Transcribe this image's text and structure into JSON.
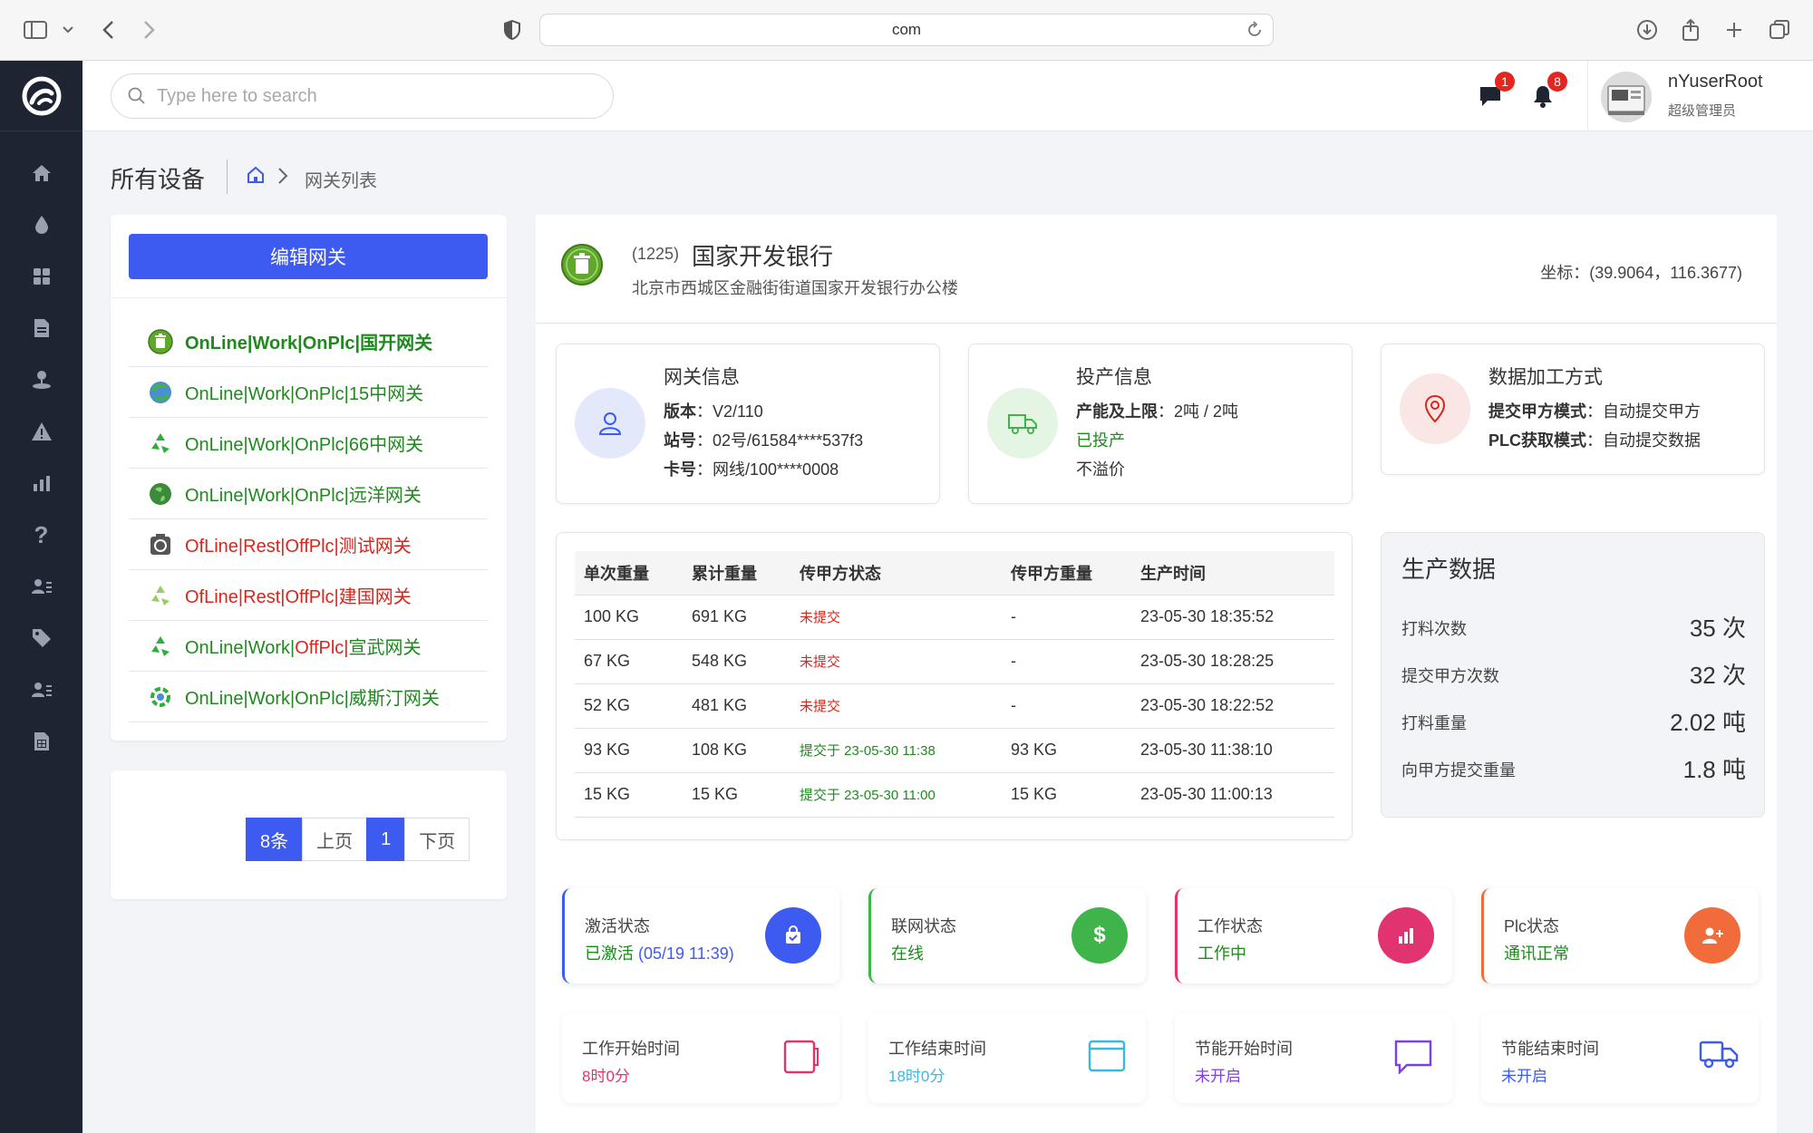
{
  "browser": {
    "url": "com"
  },
  "search": {
    "placeholder": "Type here to search"
  },
  "header": {
    "messages_badge": "1",
    "notifications_badge": "8",
    "user_name": "nYuserRoot",
    "user_role": "超级管理员"
  },
  "page": {
    "title": "所有设备",
    "breadcrumb": "网关列表"
  },
  "gateways": {
    "edit_button": "编辑网关",
    "items": [
      {
        "status": "OnLine|Work|OnPlc|",
        "status_color": "green",
        "name": "国开网关",
        "icon": "trash-can-icon"
      },
      {
        "status": "OnLine|Work|OnPlc|",
        "status_color": "green",
        "name": "15中网关",
        "icon": "recycle-globe-icon"
      },
      {
        "status": "OnLine|Work|OnPlc|",
        "status_color": "green",
        "name": "66中网关",
        "icon": "recycle-icon"
      },
      {
        "status": "OnLine|Work|OnPlc|",
        "status_color": "green",
        "name": "远洋网关",
        "icon": "recycle-globe-icon"
      },
      {
        "status": "OfLine|Rest|OffPlc|",
        "status_color": "red",
        "name": "测试网关",
        "icon": "recycle-bin-icon"
      },
      {
        "status": "OfLine|Rest|OffPlc|",
        "status_color": "red",
        "name": "建国网关",
        "icon": "recycle-icon"
      },
      {
        "status_parts": [
          "OnLine|Work|",
          "OffPlc|"
        ],
        "status_color": "mixed",
        "name": "宣武网关",
        "icon": "recycle-icon"
      },
      {
        "status": "OnLine|Work|OnPlc|",
        "status_color": "green",
        "name": "威斯汀网关",
        "icon": "recycle-gear-icon"
      }
    ]
  },
  "pagination": {
    "count": "8条",
    "prev": "上页",
    "current": "1",
    "next": "下页"
  },
  "bank": {
    "id": "(1225)",
    "name": "国家开发银行",
    "address": "北京市西城区金融街街道国家开发银行办公楼",
    "coordinates": "坐标：(39.9064，116.3677)"
  },
  "gateway_info": {
    "title": "网关信息",
    "version_label": "版本",
    "version": "：V2/110",
    "station_label": "站号",
    "station": "：02号/61584****537f3",
    "card_label": "卡号",
    "card": "：网线/100****0008"
  },
  "production_info": {
    "title": "投产信息",
    "capacity_label": "产能及上限",
    "capacity": "：2吨 / 2吨",
    "status": "已投产",
    "overflow": "不溢价"
  },
  "processing": {
    "title": "数据加工方式",
    "submit_label": "提交甲方模式",
    "submit_value": "：自动提交甲方",
    "plc_label": "PLC获取模式",
    "plc_value": "：自动提交数据"
  },
  "table": {
    "headers": [
      "单次重量",
      "累计重量",
      "传甲方状态",
      "传甲方重量",
      "生产时间"
    ],
    "rows": [
      {
        "single": "100 KG",
        "total": "691 KG",
        "status": "未提交",
        "status_color": "red",
        "submitted": "-",
        "time": "23-05-30 18:35:52"
      },
      {
        "single": "67 KG",
        "total": "548 KG",
        "status": "未提交",
        "status_color": "red",
        "submitted": "-",
        "time": "23-05-30 18:28:25"
      },
      {
        "single": "52 KG",
        "total": "481 KG",
        "status": "未提交",
        "status_color": "red",
        "submitted": "-",
        "time": "23-05-30 18:22:52"
      },
      {
        "single": "93 KG",
        "total": "108 KG",
        "status": "提交于 23-05-30 11:38",
        "status_color": "green",
        "submitted": "93 KG",
        "time": "23-05-30 11:38:10"
      },
      {
        "single": "15 KG",
        "total": "15 KG",
        "status": "提交于 23-05-30 11:00",
        "status_color": "green",
        "submitted": "15 KG",
        "time": "23-05-30 11:00:13"
      }
    ]
  },
  "production_data": {
    "title": "生产数据",
    "rows": [
      {
        "label": "打料次数",
        "value": "35 次"
      },
      {
        "label": "提交甲方次数",
        "value": "32 次"
      },
      {
        "label": "打料重量",
        "value": "2.02 吨"
      },
      {
        "label": "向甲方提交重量",
        "value": "1.8 吨"
      }
    ]
  },
  "status_cards": [
    {
      "label": "激活状态",
      "value": "已激活",
      "extra": " (05/19 11:39)",
      "color": "#3d5af1",
      "value_color": "#1e8a1e",
      "icon": "shopping-bag-icon"
    },
    {
      "label": "联网状态",
      "value": "在线",
      "color": "#3fb44a",
      "value_color": "#1e8a1e",
      "icon": "dollar-icon"
    },
    {
      "label": "工作状态",
      "value": "工作中",
      "color": "#e0336f",
      "value_color": "#1e8a1e",
      "icon": "bar-chart-icon"
    },
    {
      "label": "Plc状态",
      "value": "通讯正常",
      "color": "#f26b3a",
      "value_color": "#1e8a1e",
      "icon": "add-user-icon"
    }
  ],
  "time_cards": [
    {
      "label": "工作开始时间",
      "value": "8时0分",
      "color": "#e0336f",
      "icon": "tablet-icon"
    },
    {
      "label": "工作结束时间",
      "value": "18时0分",
      "color": "#3db6e0",
      "icon": "window-icon"
    },
    {
      "label": "节能开始时间",
      "value": "未开启",
      "color": "#7b3fe4",
      "icon": "chat-icon"
    },
    {
      "label": "节能结束时间",
      "value": "未开启",
      "color": "#3d5af1",
      "icon": "truck-icon"
    }
  ]
}
